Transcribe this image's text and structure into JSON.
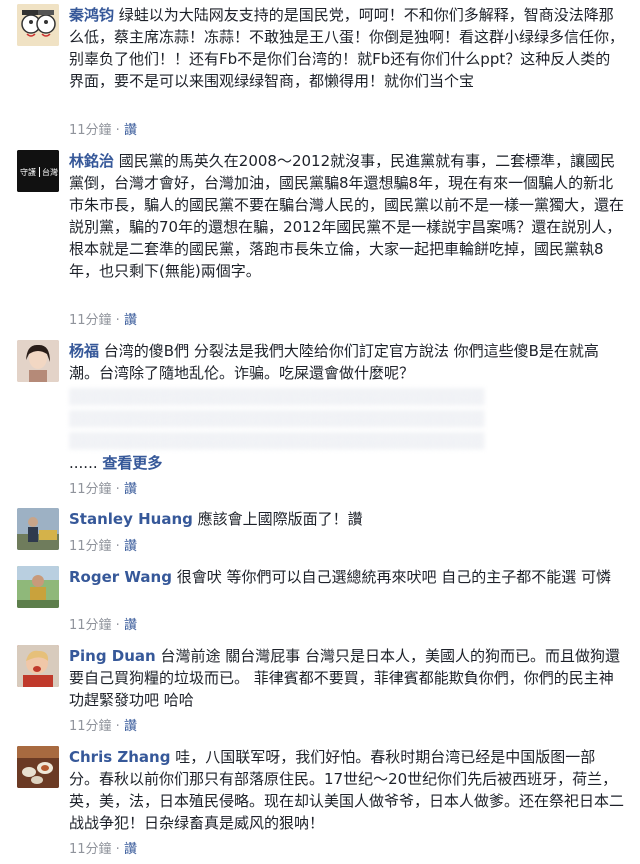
{
  "comments": [
    {
      "name": "秦鸿钧",
      "text": "绿蛙以为大陆网友支持的是国民党，呵呵！不和你们多解释，智商没法降那么低，蔡主席冻蒜！冻蒜！不敢独是王八蛋！你倒是独啊！看这群小绿绿多信任你，别辜负了他们！！还有Fb不是你们台湾的！就Fb还有你们什么ppt？这种反人类的界面，要不是可以来围观绿绿智商，都懒得用！就你们当个宝",
      "time": "11分鐘",
      "like": "讚"
    },
    {
      "name": "林銘治",
      "text": "國民黨的馬英久在2008～2012就沒事，民進黨就有事，二套標準，讓國民黨倒，台灣才會好，台灣加油，國民黨騙8年還想騙8年，現在有來一個騙人的新北市朱市長，騙人的國民黨不要在騙台灣人民的，國民黨以前不是一樣一黨獨大，還在説別黨，騙的70年的還想在騙，2012年國民黨不是一樣説宇昌案嗎？還在説別人，根本就是二套準的國民黨，落跑市長朱立倫，大家一起把車輪餅吃掉，國民黨執8年，也只剩下(無能)兩個字。",
      "time": "11分鐘",
      "like": "讚"
    },
    {
      "name": "杨福",
      "text": "台湾的傻B們 分裂法是我們大陸给你们訂定官方說法 你們這些傻B是在就高潮。台湾除了隨地乱伦。诈骗。吃屎還會做什麼呢？",
      "see_more_dots": "......",
      "see_more": "查看更多",
      "time": "11分鐘",
      "like": "讚"
    },
    {
      "name": "Stanley Huang",
      "text": "應該會上國際版面了！讚",
      "time": "11分鐘",
      "like": "讚"
    },
    {
      "name": "Roger Wang",
      "text": "很會吠 等你們可以自己選總統再來吠吧 自己的主子都不能選 可憐",
      "time": "11分鐘",
      "like": "讚"
    },
    {
      "name": "Ping Duan",
      "text": "台灣前途 關台灣屁事 台灣只是日本人，美國人的狗而已。而且做狗還要自己買狗糧的垃圾而已。 菲律賓都不要買，菲律賓都能欺負你們，你們的民主神功趕緊發功吧 哈哈",
      "time": "11分鐘",
      "like": "讚"
    },
    {
      "name": "Chris Zhang",
      "text": "哇，八国联军呀，我们好怕。春秋时期台湾已经是中国版图一部分。春秋以前你们那只有部落原住民。17世纪～20世纪你们先后被西班牙，荷兰，英，美，法，日本殖民侵略。现在却认美国人做爷爷，日本人做爹。还在祭祀日本二战战争犯！日杂绿畜真是威风的狠呐！",
      "time": "11分鐘",
      "like": "讚"
    }
  ],
  "colors": {
    "link": "#365899",
    "meta": "#90949c",
    "text": "#1d2129"
  }
}
